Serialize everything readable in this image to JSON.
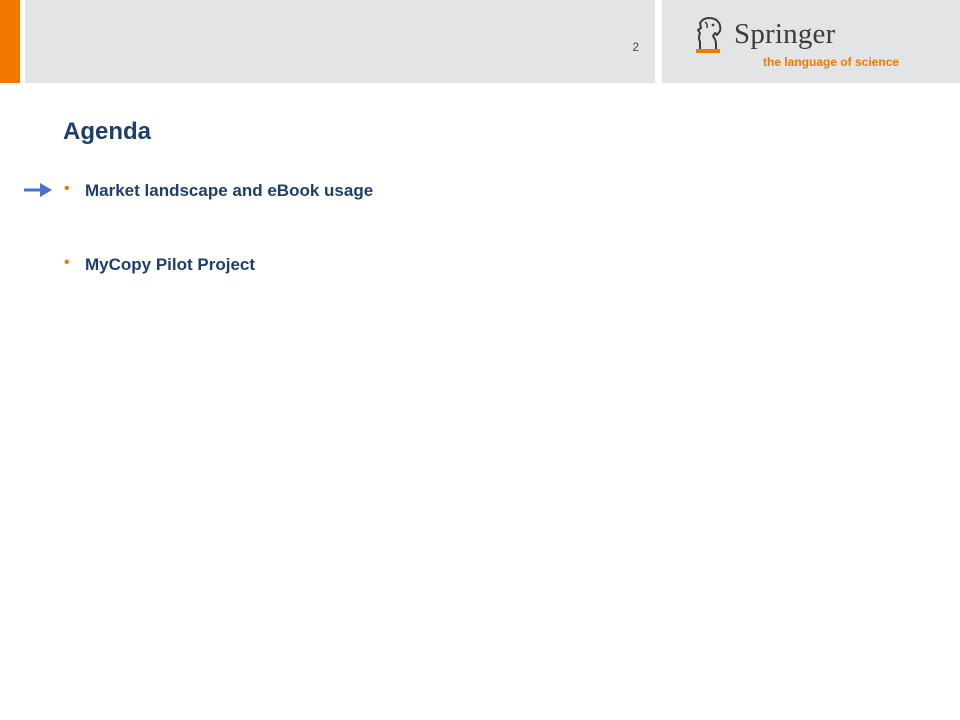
{
  "header": {
    "page_number": "2"
  },
  "logo": {
    "wordmark": "Springer",
    "tagline": "the language of science"
  },
  "slide": {
    "title": "Agenda",
    "items": [
      {
        "label": "Market landscape and eBook usage",
        "current": true
      },
      {
        "label": "MyCopy Pilot Project",
        "current": false
      }
    ]
  },
  "colors": {
    "accent_orange": "#f07800",
    "title_navy": "#1c3f6e",
    "header_gray": "#e3e4e6",
    "arrow_blue": "#4a6fd0"
  },
  "icons": {
    "logo": "springer-horse-icon",
    "current_item": "arrow-right-icon",
    "bullet": "bullet-dot-icon"
  }
}
